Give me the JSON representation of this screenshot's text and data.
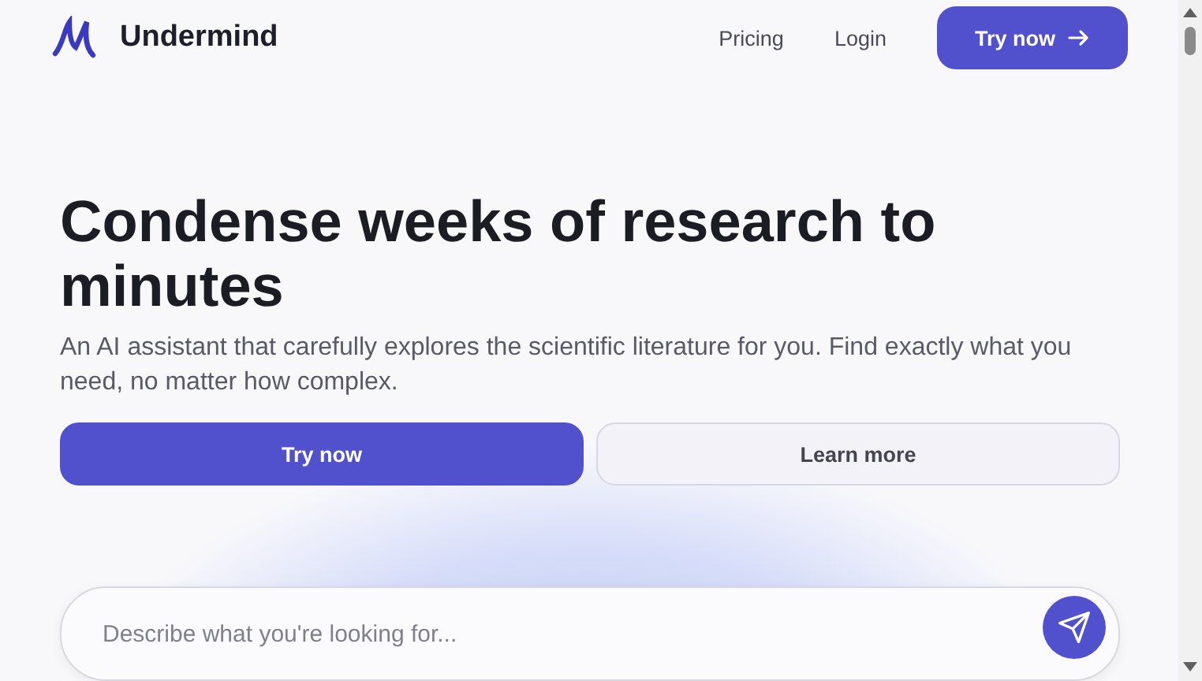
{
  "header": {
    "brand": "Undermind",
    "nav": [
      "Pricing",
      "Login"
    ],
    "cta": "Try now"
  },
  "hero": {
    "title": "Condense weeks of research to minutes",
    "subtitle": "An AI assistant that carefully explores the scientific literature for you. Find exactly what you need, no matter how complex.",
    "buttons": [
      {
        "label": "Try now",
        "kind": "primary"
      },
      {
        "label": "Learn more",
        "kind": "secondary"
      }
    ]
  },
  "search": {
    "placeholder": "Describe what you're looking for..."
  }
}
